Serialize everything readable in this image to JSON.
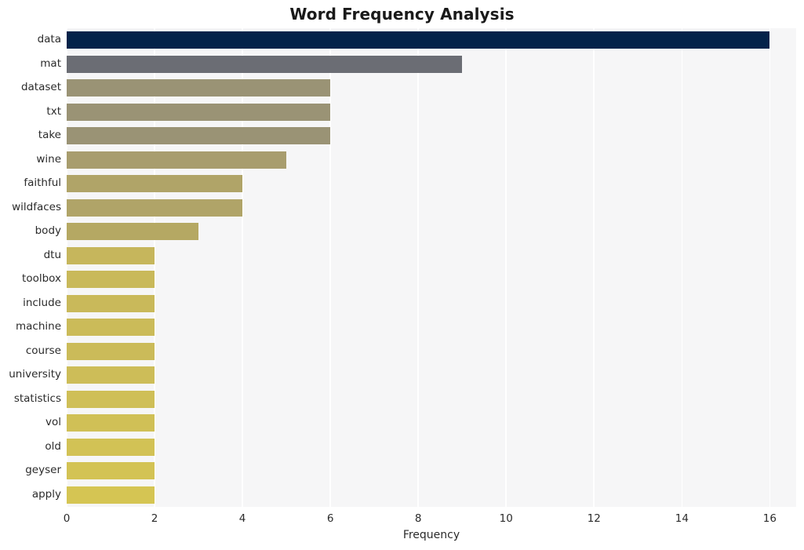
{
  "chart_data": {
    "type": "bar",
    "orientation": "horizontal",
    "title": "Word Frequency Analysis",
    "xlabel": "Frequency",
    "ylabel": "",
    "xlim": [
      0,
      16.6
    ],
    "ylim": [
      0,
      20
    ],
    "grid": "vertical-only",
    "legend": "none",
    "xticks": [
      "0",
      "2",
      "4",
      "6",
      "8",
      "10",
      "12",
      "14",
      "16"
    ],
    "xtick_values": [
      0,
      2,
      4,
      6,
      8,
      10,
      12,
      14,
      16
    ],
    "categories": [
      "data",
      "mat",
      "dataset",
      "txt",
      "take",
      "wine",
      "faithful",
      "wildfaces",
      "body",
      "dtu",
      "toolbox",
      "include",
      "machine",
      "course",
      "university",
      "statistics",
      "vol",
      "old",
      "geyser",
      "apply"
    ],
    "values": [
      16,
      9,
      6,
      6,
      6,
      5,
      4,
      4,
      3,
      2,
      2,
      2,
      2,
      2,
      2,
      2,
      2,
      2,
      2,
      2
    ],
    "bar_colors": [
      "#04234a",
      "#6b6d74",
      "#9a9375",
      "#9a9375",
      "#9a9375",
      "#a89d6e",
      "#b0a468",
      "#b0a468",
      "#b5a863",
      "#c6b65c",
      "#c9b95a",
      "#c9b95a",
      "#cbbb59",
      "#cbbb59",
      "#cdbd58",
      "#cfbf57",
      "#d0c056",
      "#d2c255",
      "#d3c354",
      "#d5c553"
    ],
    "plot_background": "#f6f6f7",
    "figure_background": "#ffffff",
    "gridline_color": "#ffffff",
    "title_color": "#1a1a1a",
    "tick_label_color": "#2b2b2b"
  }
}
